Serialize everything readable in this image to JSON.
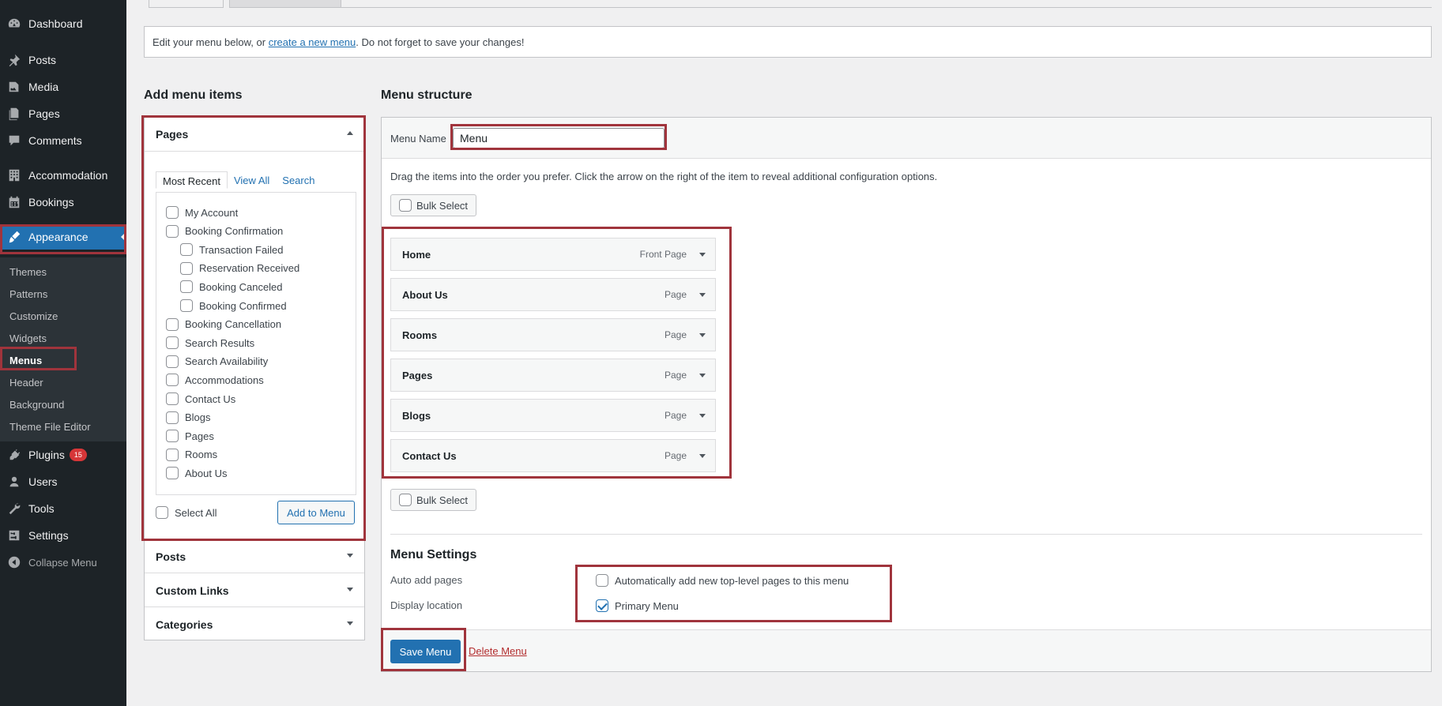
{
  "sidebar": {
    "items": [
      {
        "label": "Dashboard",
        "icon": "dashboard-icon"
      },
      {
        "label": "Posts",
        "icon": "pin-icon"
      },
      {
        "label": "Media",
        "icon": "media-icon"
      },
      {
        "label": "Pages",
        "icon": "page-icon"
      },
      {
        "label": "Comments",
        "icon": "comment-icon"
      },
      {
        "label": "Accommodation",
        "icon": "building-icon"
      },
      {
        "label": "Bookings",
        "icon": "calendar-icon"
      },
      {
        "label": "Appearance",
        "icon": "brush-icon"
      },
      {
        "label": "Plugins",
        "icon": "plug-icon",
        "badge": "15"
      },
      {
        "label": "Users",
        "icon": "user-icon"
      },
      {
        "label": "Tools",
        "icon": "wrench-icon"
      },
      {
        "label": "Settings",
        "icon": "settings-icon"
      },
      {
        "label": "Collapse Menu",
        "icon": "collapse-icon"
      }
    ],
    "submenu": [
      "Themes",
      "Patterns",
      "Customize",
      "Widgets",
      "Menus",
      "Header",
      "Background",
      "Theme File Editor"
    ]
  },
  "notice": {
    "before": "Edit your menu below, or ",
    "link": "create a new menu",
    "after": ". Do not forget to save your changes!"
  },
  "add_items": {
    "heading": "Add menu items",
    "pages_title": "Pages",
    "tabs": [
      "Most Recent",
      "View All",
      "Search"
    ],
    "pages": [
      {
        "label": "My Account",
        "child": false
      },
      {
        "label": "Booking Confirmation",
        "child": false
      },
      {
        "label": "Transaction Failed",
        "child": true
      },
      {
        "label": "Reservation Received",
        "child": true
      },
      {
        "label": "Booking Canceled",
        "child": true
      },
      {
        "label": "Booking Confirmed",
        "child": true
      },
      {
        "label": "Booking Cancellation",
        "child": false
      },
      {
        "label": "Search Results",
        "child": false
      },
      {
        "label": "Search Availability",
        "child": false
      },
      {
        "label": "Accommodations",
        "child": false
      },
      {
        "label": "Contact Us",
        "child": false
      },
      {
        "label": "Blogs",
        "child": false
      },
      {
        "label": "Pages",
        "child": false
      },
      {
        "label": "Rooms",
        "child": false
      },
      {
        "label": "About Us",
        "child": false
      }
    ],
    "select_all": "Select All",
    "add_button": "Add to Menu",
    "other_sections": [
      "Posts",
      "Custom Links",
      "Categories"
    ]
  },
  "structure": {
    "heading": "Menu structure",
    "name_label": "Menu Name",
    "name_value": "Menu",
    "instructions": "Drag the items into the order you prefer. Click the arrow on the right of the item to reveal additional configuration options.",
    "bulk_select": "Bulk Select",
    "items": [
      {
        "title": "Home",
        "type": "Front Page"
      },
      {
        "title": "About Us",
        "type": "Page"
      },
      {
        "title": "Rooms",
        "type": "Page"
      },
      {
        "title": "Pages",
        "type": "Page"
      },
      {
        "title": "Blogs",
        "type": "Page"
      },
      {
        "title": "Contact Us",
        "type": "Page"
      }
    ],
    "settings_heading": "Menu Settings",
    "auto_add_label": "Auto add pages",
    "auto_add_text": "Automatically add new top-level pages to this menu",
    "auto_add_checked": false,
    "display_label": "Display location",
    "display_text": "Primary Menu",
    "display_checked": true,
    "save": "Save Menu",
    "delete": "Delete Menu"
  },
  "colors": {
    "accent": "#2271b1",
    "sidebar": "#1d2327",
    "highlight": "#a0343c",
    "badge": "#d63638"
  }
}
